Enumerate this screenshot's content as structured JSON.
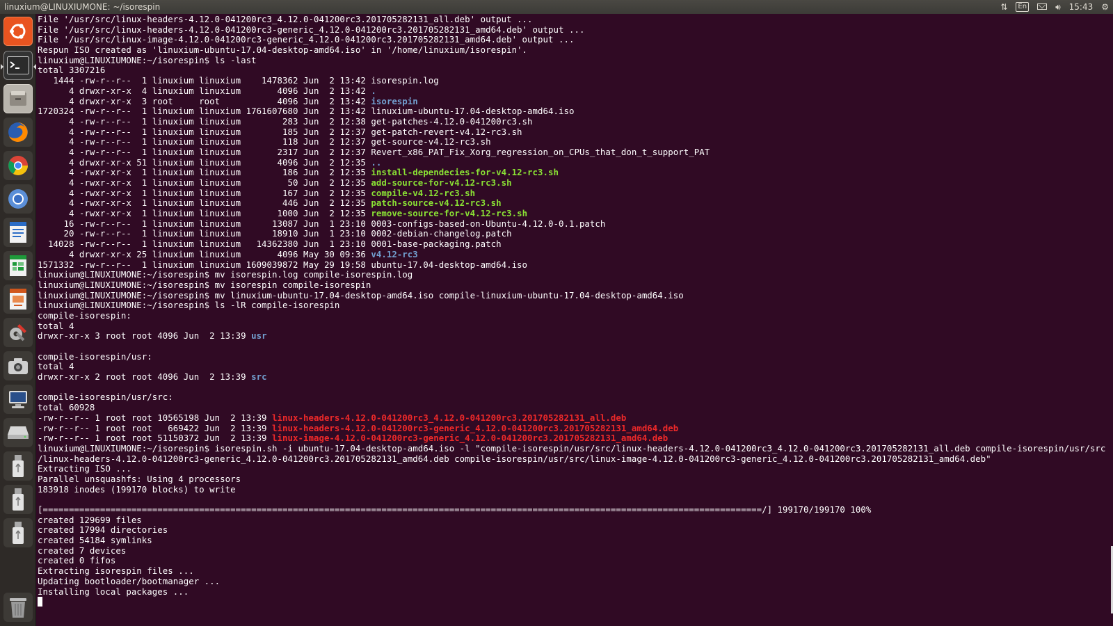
{
  "window": {
    "title": "linuxium@LINUXIUMONE: ~/isorespin"
  },
  "indicators": {
    "keyboard": "En",
    "time": "15:43"
  },
  "colors": {
    "background": "#300a24",
    "text": "#ffffff",
    "directory": "#729fcf",
    "executable": "#8ae234",
    "archive": "#ef2929"
  },
  "launcher": [
    {
      "name": "ubuntu-dash-icon"
    },
    {
      "name": "terminal-icon"
    },
    {
      "name": "files-icon"
    },
    {
      "name": "firefox-icon"
    },
    {
      "name": "chrome-icon"
    },
    {
      "name": "chromium-icon"
    },
    {
      "name": "writer-icon"
    },
    {
      "name": "calc-icon"
    },
    {
      "name": "impress-icon"
    },
    {
      "name": "system-settings-icon"
    },
    {
      "name": "camera-icon"
    },
    {
      "name": "remote-desktop-icon"
    },
    {
      "name": "drive-icon"
    },
    {
      "name": "usb-drive-icon-1"
    },
    {
      "name": "usb-drive-icon-2"
    },
    {
      "name": "usb-drive-icon-3"
    },
    {
      "name": "trash-icon"
    }
  ],
  "terminal": {
    "lines": [
      [
        {
          "t": "File '/usr/src/linux-headers-4.12.0-041200rc3_4.12.0-041200rc3.201705282131_all.deb' output ..."
        }
      ],
      [
        {
          "t": "File '/usr/src/linux-headers-4.12.0-041200rc3-generic_4.12.0-041200rc3.201705282131_amd64.deb' output ..."
        }
      ],
      [
        {
          "t": "File '/usr/src/linux-image-4.12.0-041200rc3-generic_4.12.0-041200rc3.201705282131_amd64.deb' output ..."
        }
      ],
      [
        {
          "t": "Respun ISO created as 'linuxium-ubuntu-17.04-desktop-amd64.iso' in '/home/linuxium/isorespin'."
        }
      ],
      [
        {
          "t": "linuxium@LINUXIUMONE:~/isorespin$ ls -last"
        }
      ],
      [
        {
          "t": "total 3307216"
        }
      ],
      [
        {
          "t": "   1444 -rw-r--r--  1 linuxium linuxium    1478362 Jun  2 13:42 isorespin.log"
        }
      ],
      [
        {
          "t": "      4 drwxr-xr-x  4 linuxium linuxium       4096 Jun  2 13:42 "
        },
        {
          "t": ".",
          "c": "blue"
        }
      ],
      [
        {
          "t": "      4 drwxr-xr-x  3 root     root           4096 Jun  2 13:42 "
        },
        {
          "t": "isorespin",
          "c": "blue"
        }
      ],
      [
        {
          "t": "1720324 -rw-r--r--  1 linuxium linuxium 1761607680 Jun  2 13:42 linuxium-ubuntu-17.04-desktop-amd64.iso"
        }
      ],
      [
        {
          "t": "      4 -rw-r--r--  1 linuxium linuxium        283 Jun  2 12:38 get-patches-4.12.0-041200rc3.sh"
        }
      ],
      [
        {
          "t": "      4 -rw-r--r--  1 linuxium linuxium        185 Jun  2 12:37 get-patch-revert-v4.12-rc3.sh"
        }
      ],
      [
        {
          "t": "      4 -rw-r--r--  1 linuxium linuxium        118 Jun  2 12:37 get-source-v4.12-rc3.sh"
        }
      ],
      [
        {
          "t": "      4 -rw-r--r--  1 linuxium linuxium       2317 Jun  2 12:37 Revert_x86_PAT_Fix_Xorg_regression_on_CPUs_that_don_t_support_PAT"
        }
      ],
      [
        {
          "t": "      4 drwxr-xr-x 51 linuxium linuxium       4096 Jun  2 12:35 "
        },
        {
          "t": "..",
          "c": "blue"
        }
      ],
      [
        {
          "t": "      4 -rwxr-xr-x  1 linuxium linuxium        186 Jun  2 12:35 "
        },
        {
          "t": "install-dependecies-for-v4.12-rc3.sh",
          "c": "green"
        }
      ],
      [
        {
          "t": "      4 -rwxr-xr-x  1 linuxium linuxium         50 Jun  2 12:35 "
        },
        {
          "t": "add-source-for-v4.12-rc3.sh",
          "c": "green"
        }
      ],
      [
        {
          "t": "      4 -rwxr-xr-x  1 linuxium linuxium        167 Jun  2 12:35 "
        },
        {
          "t": "compile-v4.12-rc3.sh",
          "c": "green"
        }
      ],
      [
        {
          "t": "      4 -rwxr-xr-x  1 linuxium linuxium        446 Jun  2 12:35 "
        },
        {
          "t": "patch-source-v4.12-rc3.sh",
          "c": "green"
        }
      ],
      [
        {
          "t": "      4 -rwxr-xr-x  1 linuxium linuxium       1000 Jun  2 12:35 "
        },
        {
          "t": "remove-source-for-v4.12-rc3.sh",
          "c": "green"
        }
      ],
      [
        {
          "t": "     16 -rw-r--r--  1 linuxium linuxium      13087 Jun  1 23:10 0003-configs-based-on-Ubuntu-4.12.0-0.1.patch"
        }
      ],
      [
        {
          "t": "     20 -rw-r--r--  1 linuxium linuxium      18910 Jun  1 23:10 0002-debian-changelog.patch"
        }
      ],
      [
        {
          "t": "  14028 -rw-r--r--  1 linuxium linuxium   14362380 Jun  1 23:10 0001-base-packaging.patch"
        }
      ],
      [
        {
          "t": "      4 drwxr-xr-x 25 linuxium linuxium       4096 May 30 09:36 "
        },
        {
          "t": "v4.12-rc3",
          "c": "blue"
        }
      ],
      [
        {
          "t": "1571332 -rw-r--r--  1 linuxium linuxium 1609039872 May 29 19:58 ubuntu-17.04-desktop-amd64.iso"
        }
      ],
      [
        {
          "t": "linuxium@LINUXIUMONE:~/isorespin$ mv isorespin.log compile-isorespin.log"
        }
      ],
      [
        {
          "t": "linuxium@LINUXIUMONE:~/isorespin$ mv isorespin compile-isorespin"
        }
      ],
      [
        {
          "t": "linuxium@LINUXIUMONE:~/isorespin$ mv linuxium-ubuntu-17.04-desktop-amd64.iso compile-linuxium-ubuntu-17.04-desktop-amd64.iso"
        }
      ],
      [
        {
          "t": "linuxium@LINUXIUMONE:~/isorespin$ ls -lR compile-isorespin"
        }
      ],
      [
        {
          "t": "compile-isorespin:"
        }
      ],
      [
        {
          "t": "total 4"
        }
      ],
      [
        {
          "t": "drwxr-xr-x 3 root root 4096 Jun  2 13:39 "
        },
        {
          "t": "usr",
          "c": "blue"
        }
      ],
      [
        {
          "t": ""
        }
      ],
      [
        {
          "t": "compile-isorespin/usr:"
        }
      ],
      [
        {
          "t": "total 4"
        }
      ],
      [
        {
          "t": "drwxr-xr-x 2 root root 4096 Jun  2 13:39 "
        },
        {
          "t": "src",
          "c": "blue"
        }
      ],
      [
        {
          "t": ""
        }
      ],
      [
        {
          "t": "compile-isorespin/usr/src:"
        }
      ],
      [
        {
          "t": "total 60928"
        }
      ],
      [
        {
          "t": "-rw-r--r-- 1 root root 10565198 Jun  2 13:39 "
        },
        {
          "t": "linux-headers-4.12.0-041200rc3_4.12.0-041200rc3.201705282131_all.deb",
          "c": "red"
        }
      ],
      [
        {
          "t": "-rw-r--r-- 1 root root   669422 Jun  2 13:39 "
        },
        {
          "t": "linux-headers-4.12.0-041200rc3-generic_4.12.0-041200rc3.201705282131_amd64.deb",
          "c": "red"
        }
      ],
      [
        {
          "t": "-rw-r--r-- 1 root root 51150372 Jun  2 13:39 "
        },
        {
          "t": "linux-image-4.12.0-041200rc3-generic_4.12.0-041200rc3.201705282131_amd64.deb",
          "c": "red"
        }
      ],
      [
        {
          "t": "linuxium@LINUXIUMONE:~/isorespin$ isorespin.sh -i ubuntu-17.04-desktop-amd64.iso -l \"compile-isorespin/usr/src/linux-headers-4.12.0-041200rc3_4.12.0-041200rc3.201705282131_all.deb compile-isorespin/usr/src"
        }
      ],
      [
        {
          "t": "/linux-headers-4.12.0-041200rc3-generic_4.12.0-041200rc3.201705282131_amd64.deb compile-isorespin/usr/src/linux-image-4.12.0-041200rc3-generic_4.12.0-041200rc3.201705282131_amd64.deb\""
        }
      ],
      [
        {
          "t": "Extracting ISO ..."
        }
      ],
      [
        {
          "t": "Parallel unsquashfs: Using 4 processors"
        }
      ],
      [
        {
          "t": "183918 inodes (199170 blocks) to write"
        }
      ],
      [
        {
          "t": ""
        }
      ],
      [
        {
          "t": "[==========================================================================================================================================/] 199170/199170 100%"
        }
      ],
      [
        {
          "t": "created 129699 files"
        }
      ],
      [
        {
          "t": "created 17994 directories"
        }
      ],
      [
        {
          "t": "created 54184 symlinks"
        }
      ],
      [
        {
          "t": "created 7 devices"
        }
      ],
      [
        {
          "t": "created 0 fifos"
        }
      ],
      [
        {
          "t": "Extracting isorespin files ..."
        }
      ],
      [
        {
          "t": "Updating bootloader/bootmanager ..."
        }
      ],
      [
        {
          "t": "Installing local packages ..."
        }
      ]
    ]
  }
}
